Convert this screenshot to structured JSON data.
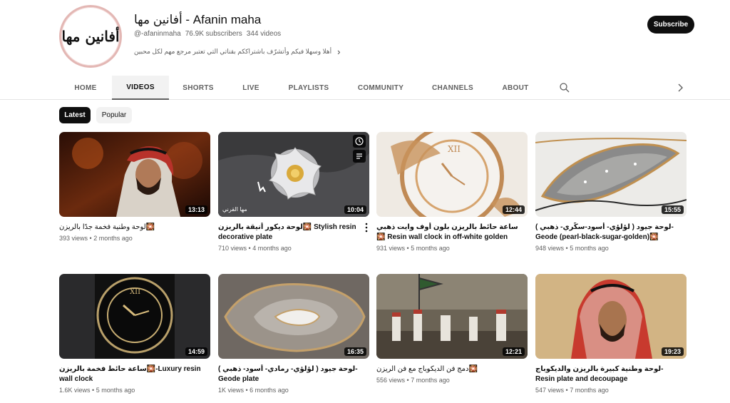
{
  "channel": {
    "avatar_text": "أفانين مها",
    "title": "أفانين مها - Afanin maha",
    "handle": "@-afaninmaha",
    "subscribers": "76.9K subscribers",
    "videos_count": "344 videos",
    "description": "أهلا وسهلا فيكم وأتشرّف باشتراككم بقناتي التي تعتبر مرجع مهم لكل محبين",
    "subscribe_label": "Subscribe"
  },
  "tabs": [
    "HOME",
    "VIDEOS",
    "SHORTS",
    "LIVE",
    "PLAYLISTS",
    "COMMUNITY",
    "CHANNELS",
    "ABOUT"
  ],
  "active_tab": "VIDEOS",
  "chips": {
    "latest": "Latest",
    "popular": "Popular"
  },
  "videos": [
    {
      "title": "لوحة وطنية فخمة جدًا بالريزن🎇",
      "views": "393 views",
      "age": "2 months ago",
      "duration": "13:13"
    },
    {
      "title": "لوحة ديكور أنيقة بالريزن🎇 Stylish resin decorative plate",
      "views": "710 views",
      "age": "4 months ago",
      "duration": "10:04"
    },
    {
      "title": "ساعة حائط بالريزن بلون أوف وايت ذهبي🎇 Resin wall clock in off-white golden color🎇",
      "views": "931 views",
      "age": "5 months ago",
      "duration": "12:44"
    },
    {
      "title": "لوحة جيود ( لؤلؤي- أسود-سكّري- ذهبي )-Geode (pearl-black-sugar-golden)🎇",
      "views": "948 views",
      "age": "5 months ago",
      "duration": "15:55"
    },
    {
      "title": "ساعة حائط فخمة بالريزن🎇-Luxury resin wall clock",
      "views": "1.6K views",
      "age": "5 months ago",
      "duration": "14:59"
    },
    {
      "title": "لوحة جيود ( لؤلؤي- رمادي- أسود- ذهبي )-Geode plate",
      "views": "1K views",
      "age": "6 months ago",
      "duration": "16:35"
    },
    {
      "title": "دمج فن الديكوباج مع فن الريزن🎇",
      "views": "556 views",
      "age": "7 months ago",
      "duration": "12:21"
    },
    {
      "title": "لوحة وطنية كبيرة بالريزن والديكوباج-Resin plate and decoupage",
      "views": "547 views",
      "age": "7 months ago",
      "duration": "19:23"
    }
  ],
  "thumb_overlay_text": "مها القرني",
  "colors": {
    "subscribe_bg": "#0f0f0f",
    "accent_ring": "#e3b7b4"
  }
}
